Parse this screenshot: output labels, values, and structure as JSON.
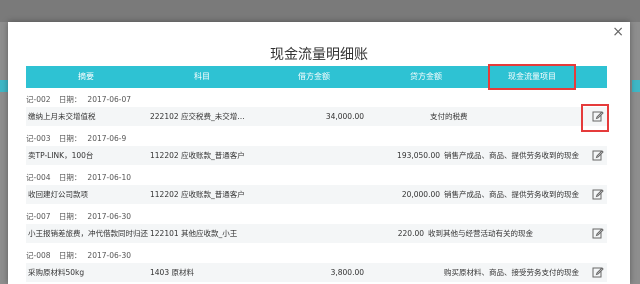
{
  "modal": {
    "title": "现金流量明细账",
    "close_label": "×"
  },
  "columns": [
    "摘要",
    "科目",
    "借方金额",
    "贷方金额",
    "现金流量项目"
  ],
  "records": [
    {
      "voucher": "记-002",
      "date_label": "日期：",
      "date": "2017-06-07",
      "summary": "缴纳上月未交增值税",
      "account": "222102 应交税费_未交增…",
      "debit": "34,000.00",
      "credit": "",
      "cash_item": "支付的税费"
    },
    {
      "voucher": "记-003",
      "date_label": "日期：",
      "date": "2017-06-9",
      "summary": "卖TP-LINK，100台",
      "account": "112202 应收账款_普通客户",
      "debit": "",
      "credit": "193,050.00",
      "cash_item": "销售产成品、商品、提供劳务收到的现金"
    },
    {
      "voucher": "记-004",
      "date_label": "日期：",
      "date": "2017-06-10",
      "summary": "收回建灯公司款项",
      "account": "112202 应收账款_普通客户",
      "debit": "",
      "credit": "20,000.00",
      "cash_item": "销售产成品、商品、提供劳务收到的现金"
    },
    {
      "voucher": "记-007",
      "date_label": "日期：",
      "date": "2017-06-30",
      "summary": "小王报销差旅费，冲代借款同时归还…",
      "account": "122101 其他应收款_小王",
      "debit": "",
      "credit": "220.00",
      "cash_item": "收到其他与经营活动有关的现金"
    },
    {
      "voucher": "记-008",
      "date_label": "日期：",
      "date": "2017-06-30",
      "summary": "采购原材料50kg",
      "account": "1403 原材料",
      "debit": "3,800.00",
      "credit": "",
      "cash_item": "购买原材料、商品、接受劳务支付的现金"
    }
  ]
}
